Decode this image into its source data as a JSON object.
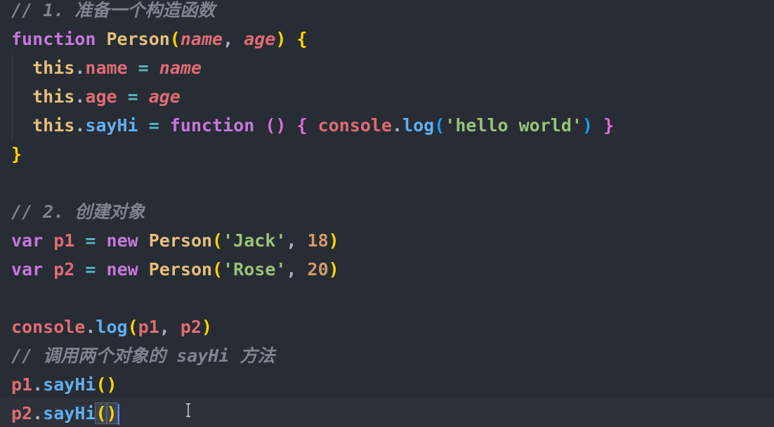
{
  "editor": {
    "language": "javascript",
    "theme_colors": {
      "background": "#282c34",
      "comment": "#7f848e",
      "keyword": "#c678dd",
      "function_name": "#e5c07b",
      "parameter": "#e06c75",
      "string": "#98c379",
      "number": "#d19a66",
      "method": "#61afef",
      "bracket_level1": "#ffd700",
      "bracket_level2": "#da70d6"
    },
    "cursor_line": 15,
    "lines": {
      "l1": {
        "comment": "// 1. 准备一个构造函数"
      },
      "l2": {
        "kw": "function",
        "name": "Person",
        "open": "(",
        "p1": "name",
        "comma": ", ",
        "p2": "age",
        "close": ")",
        "brace": "{"
      },
      "l3": {
        "this": "this",
        "dot": ".",
        "prop": "name",
        "eq": "=",
        "val": "name"
      },
      "l4": {
        "this": "this",
        "dot": ".",
        "prop": "age",
        "eq": "=",
        "val": "age"
      },
      "l5": {
        "this": "this",
        "dot": ".",
        "prop": "sayHi",
        "eq": "=",
        "kw": "function",
        "parens": "()",
        "open": "{",
        "obj": "console",
        "dot2": ".",
        "method": "log",
        "lp": "(",
        "str": "'hello world'",
        "rp": ")",
        "close": "}"
      },
      "l6": {
        "brace": "}"
      },
      "l8": {
        "comment": "// 2. 创建对象"
      },
      "l9": {
        "kw": "var",
        "name": "p1",
        "eq": "=",
        "new": "new",
        "cls": "Person",
        "lp": "(",
        "str": "'Jack'",
        "comma": ", ",
        "num": "18",
        "rp": ")"
      },
      "l10": {
        "kw": "var",
        "name": "p2",
        "eq": "=",
        "new": "new",
        "cls": "Person",
        "lp": "(",
        "str": "'Rose'",
        "comma": ", ",
        "num": "20",
        "rp": ")"
      },
      "l12": {
        "obj": "console",
        "dot": ".",
        "method": "log",
        "lp": "(",
        "a1": "p1",
        "comma": ", ",
        "a2": "p2",
        "rp": ")"
      },
      "l13": {
        "comment": "// 调用两个对象的 sayHi 方法"
      },
      "l14": {
        "obj": "p1",
        "dot": ".",
        "method": "sayHi",
        "lp": "(",
        "rp": ")"
      },
      "l15": {
        "obj": "p2",
        "dot": ".",
        "method": "sayHi",
        "lp": "(",
        "rp": ")"
      }
    }
  }
}
